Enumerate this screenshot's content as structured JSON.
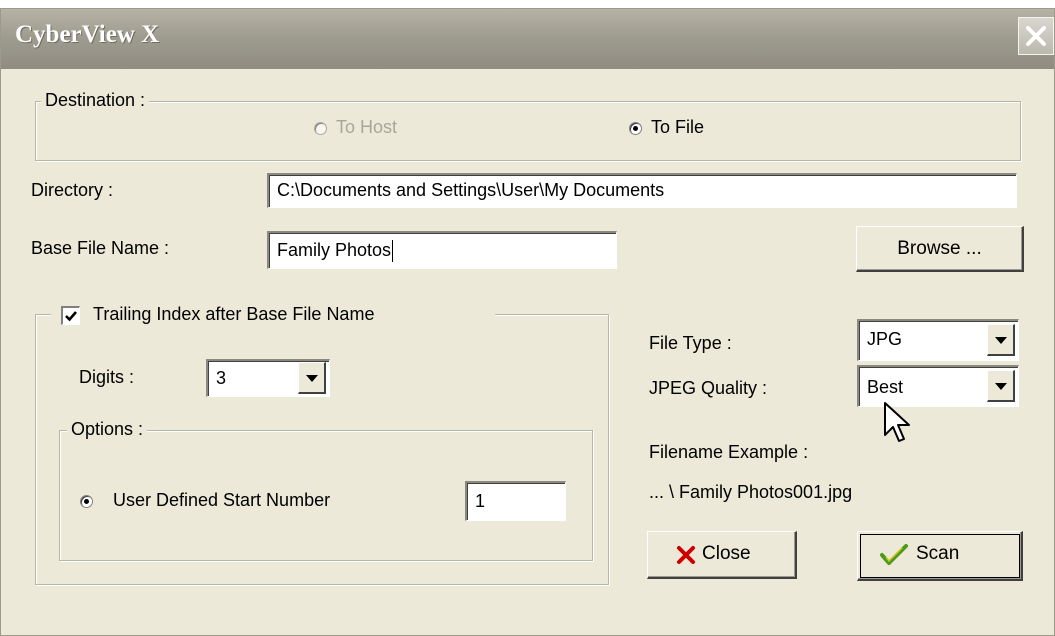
{
  "window": {
    "title": "CyberView X"
  },
  "destination": {
    "legend": "Destination :",
    "to_host_label": "To Host",
    "to_file_label": "To File",
    "selected": "To File"
  },
  "directory": {
    "label": "Directory :",
    "value": "C:\\Documents and Settings\\User\\My Documents"
  },
  "base_file_name": {
    "label": "Base File Name :",
    "value": "Family Photos"
  },
  "browse_button": {
    "label": "Browse ..."
  },
  "trailing_index": {
    "label": "Trailing Index after Base File Name",
    "checked": true,
    "digits_label": "Digits :",
    "digits_value": "3",
    "options_legend": "Options :",
    "start_number_label": "User Defined Start Number",
    "start_number_value": "1"
  },
  "file_type": {
    "label": "File Type :",
    "value": "JPG"
  },
  "jpeg_quality": {
    "label": "JPEG Quality :",
    "value": "Best"
  },
  "filename_example": {
    "label": "Filename Example :",
    "value": "... \\ Family Photos001.jpg"
  },
  "buttons": {
    "close_label": "Close",
    "scan_label": "Scan"
  },
  "icons": {
    "title_close": "close-icon",
    "close_button": "red-x-icon",
    "scan_button": "green-checkmark-icon",
    "cursor": "mouse-pointer-icon"
  },
  "colors": {
    "title_bar": "#9f9c90",
    "dialog_bg": "#ece9d8",
    "close_x": "#cc0000",
    "scan_check": "#4c9a1e"
  }
}
